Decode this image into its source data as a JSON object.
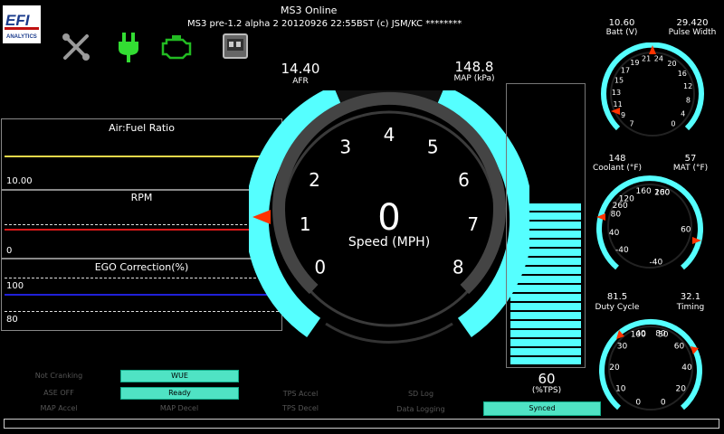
{
  "header": {
    "title": "MS3 Online",
    "firmware": "MS3 pre-1.2 alpha 2   20120926 22:55BST (c) JSM/KC ********",
    "logo_text": "EFI",
    "logo_sub": "ANALYTICS"
  },
  "toolbar_icons": [
    "tools-icon",
    "power-plug-icon",
    "check-engine-icon",
    "dashboard-icon"
  ],
  "colors": {
    "accent": "#55ffff",
    "plug": "#33dd33",
    "engine": "#22bb22",
    "needle": "#ff3300"
  },
  "afr": {
    "value": "14.40",
    "label": "AFR"
  },
  "map": {
    "value": "148.8",
    "label": "MAP (kPa)"
  },
  "speed": {
    "value": "0",
    "label": "Speed (MPH)",
    "ticks": [
      "0",
      "1",
      "2",
      "3",
      "4",
      "5",
      "6",
      "7",
      "8"
    ]
  },
  "tps": {
    "value": "60",
    "label": "(%TPS)",
    "level": 0.6
  },
  "graphs": {
    "afr": {
      "title": "Air:Fuel Ratio",
      "min": "10.00"
    },
    "rpm": {
      "title": "RPM",
      "min": "0"
    },
    "ego": {
      "title": "EGO Correction(%)",
      "ref": "100",
      "min": "80"
    }
  },
  "gauges": {
    "batt": {
      "value": "10.60",
      "label": "Batt (V)",
      "ticks": [
        "7",
        "9",
        "11",
        "13",
        "15",
        "17",
        "19",
        "21"
      ]
    },
    "pw": {
      "value": "29.420",
      "label": "Pulse Width",
      "ticks": [
        "0",
        "4",
        "8",
        "12",
        "16",
        "20",
        "24"
      ]
    },
    "clt": {
      "value": "148",
      "label": "Coolant (°F)",
      "ticks": [
        "-40",
        "60",
        "160",
        "260"
      ]
    },
    "mat": {
      "value": "57",
      "label": "MAT (°F)",
      "ticks": [
        "-40",
        "40",
        "80",
        "120",
        "160",
        "200"
      ]
    },
    "duty": {
      "value": "81.5",
      "label": "Duty Cycle",
      "ticks": [
        "0",
        "20",
        "40",
        "60",
        "80",
        "100"
      ]
    },
    "timing": {
      "value": "32.1",
      "label": "Timing",
      "ticks": [
        "0",
        "10",
        "20",
        "30",
        "40",
        "50"
      ]
    }
  },
  "indicators": {
    "not_cranking": "Not Cranking",
    "wue": "WUE",
    "ase_off": "ASE OFF",
    "ready": "Ready",
    "tps_accel": "TPS Accel",
    "sd_log": "SD Log",
    "map_accel": "MAP Accel",
    "map_decel": "MAP Decel",
    "tps_decel": "TPS Decel",
    "data_logging": "Data Logging",
    "synced": "Synced"
  }
}
